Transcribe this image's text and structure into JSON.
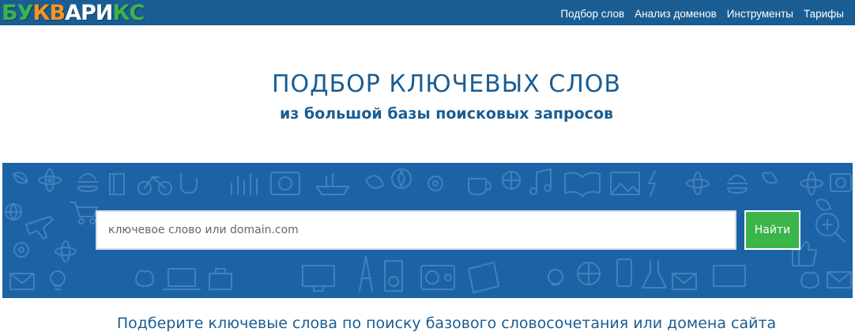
{
  "logo": {
    "letters": [
      "Б",
      "У",
      "К",
      "В",
      "А",
      "Р",
      "И",
      "К",
      "С"
    ],
    "colors": [
      "#3bb54a",
      "#3bb54a",
      "#f7941d",
      "#f7941d",
      "#ffffff",
      "#ffffff",
      "#ffffff",
      "#3bb54a",
      "#3bb54a"
    ]
  },
  "nav": {
    "items": [
      {
        "label": "Подбор слов"
      },
      {
        "label": "Анализ доменов"
      },
      {
        "label": "Инструменты"
      },
      {
        "label": "Тарифы"
      }
    ]
  },
  "hero": {
    "title": "ПОДБОР КЛЮЧЕВЫХ СЛОВ",
    "subtitle": "из большой базы поисковых запросов"
  },
  "search": {
    "placeholder": "ключевое слово или domain.com",
    "value": "",
    "button_label": "Найти"
  },
  "caption": "Подберите ключевые слова по поиску базового словосочетания или домена сайта",
  "colors": {
    "brand_blue": "#1a5d92",
    "band_blue": "#1c63a6",
    "button_green": "#3bb54a",
    "logo_orange": "#f7941d"
  },
  "pattern_icons": [
    "leaf-icon",
    "atom-icon",
    "airplane-icon",
    "coffee-icon",
    "laptop-icon",
    "envelope-icon",
    "gear-icon",
    "music-note-icon",
    "book-icon",
    "cart-icon",
    "trophy-icon",
    "bulb-icon",
    "tower-icon",
    "flask-icon",
    "magnifier-icon",
    "cloud-icon"
  ]
}
